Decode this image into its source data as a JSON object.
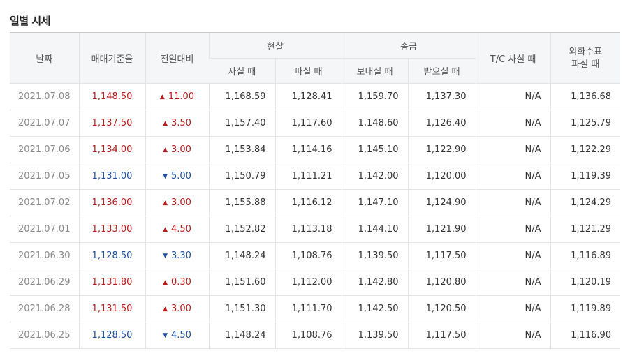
{
  "title": "일별 시세",
  "headers": {
    "date": "날짜",
    "base_rate": "매매기준율",
    "change": "전일대비",
    "cash": "현찰",
    "cash_buy": "사실 때",
    "cash_sell": "파실 때",
    "remit": "송금",
    "remit_send": "보내실 때",
    "remit_receive": "받으실 때",
    "tc_buy": "T/C 사실 때",
    "check_sell_line1": "외화수표",
    "check_sell_line2": "파실 때"
  },
  "colors": {
    "up": "#b91c1c",
    "down": "#1d4e9e",
    "header_bg": "#f5f6f8"
  },
  "rows": [
    {
      "date": "2021.07.08",
      "base": "1,148.50",
      "dir": "up",
      "change": "11.00",
      "cash_buy": "1,168.59",
      "cash_sell": "1,128.41",
      "send": "1,159.70",
      "receive": "1,137.30",
      "tc": "N/A",
      "check": "1,136.68"
    },
    {
      "date": "2021.07.07",
      "base": "1,137.50",
      "dir": "up",
      "change": "3.50",
      "cash_buy": "1,157.40",
      "cash_sell": "1,117.60",
      "send": "1,148.60",
      "receive": "1,126.40",
      "tc": "N/A",
      "check": "1,125.79"
    },
    {
      "date": "2021.07.06",
      "base": "1,134.00",
      "dir": "up",
      "change": "3.00",
      "cash_buy": "1,153.84",
      "cash_sell": "1,114.16",
      "send": "1,145.10",
      "receive": "1,122.90",
      "tc": "N/A",
      "check": "1,122.29"
    },
    {
      "date": "2021.07.05",
      "base": "1,131.00",
      "dir": "down",
      "change": "5.00",
      "cash_buy": "1,150.79",
      "cash_sell": "1,111.21",
      "send": "1,142.00",
      "receive": "1,120.00",
      "tc": "N/A",
      "check": "1,119.39"
    },
    {
      "date": "2021.07.02",
      "base": "1,136.00",
      "dir": "up",
      "change": "3.00",
      "cash_buy": "1,155.88",
      "cash_sell": "1,116.12",
      "send": "1,147.10",
      "receive": "1,124.90",
      "tc": "N/A",
      "check": "1,124.29"
    },
    {
      "date": "2021.07.01",
      "base": "1,133.00",
      "dir": "up",
      "change": "4.50",
      "cash_buy": "1,152.82",
      "cash_sell": "1,113.18",
      "send": "1,144.10",
      "receive": "1,121.90",
      "tc": "N/A",
      "check": "1,121.29"
    },
    {
      "date": "2021.06.30",
      "base": "1,128.50",
      "dir": "down",
      "change": "3.30",
      "cash_buy": "1,148.24",
      "cash_sell": "1,108.76",
      "send": "1,139.50",
      "receive": "1,117.50",
      "tc": "N/A",
      "check": "1,116.89"
    },
    {
      "date": "2021.06.29",
      "base": "1,131.80",
      "dir": "up",
      "change": "0.30",
      "cash_buy": "1,151.60",
      "cash_sell": "1,112.00",
      "send": "1,142.80",
      "receive": "1,120.80",
      "tc": "N/A",
      "check": "1,120.19"
    },
    {
      "date": "2021.06.28",
      "base": "1,131.50",
      "dir": "up",
      "change": "3.00",
      "cash_buy": "1,151.30",
      "cash_sell": "1,111.70",
      "send": "1,142.50",
      "receive": "1,120.50",
      "tc": "N/A",
      "check": "1,119.89"
    },
    {
      "date": "2021.06.25",
      "base": "1,128.50",
      "dir": "down",
      "change": "4.50",
      "cash_buy": "1,148.24",
      "cash_sell": "1,108.76",
      "send": "1,139.50",
      "receive": "1,117.50",
      "tc": "N/A",
      "check": "1,116.90"
    }
  ]
}
